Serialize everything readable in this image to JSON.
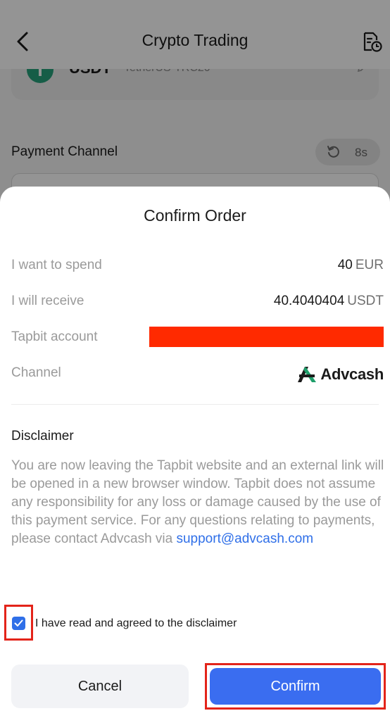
{
  "header": {
    "title": "Crypto Trading",
    "back_icon": "chevron-left-icon",
    "orders_icon": "document-clock-icon"
  },
  "token": {
    "symbol": "USDT",
    "network": "TetherUS-TRC20"
  },
  "payment": {
    "label": "Payment Channel",
    "refresh_countdown": "8s"
  },
  "modal": {
    "title": "Confirm Order",
    "rows": {
      "spend_label": "I want to spend",
      "spend_amount": "40",
      "spend_currency": "EUR",
      "receive_label": "I will receive",
      "receive_amount": "40.4040404",
      "receive_currency": "USDT",
      "account_label": "Tapbit account",
      "channel_label": "Channel",
      "channel_name": "Advcash"
    },
    "disclaimer": {
      "title": "Disclaimer",
      "text": "You are now leaving the Tapbit website and an external link will be opened in a new browser window. Tapbit does not assume any responsibility for any loss or damage caused by the use of this payment service. For any questions relating to payments, please contact Advcash via",
      "email": "support@advcash.com"
    },
    "agree": {
      "label": "I have read and agreed to the disclaimer",
      "checked": true
    },
    "buttons": {
      "cancel": "Cancel",
      "confirm": "Confirm"
    }
  },
  "colors": {
    "primary": "#3a6df0",
    "link": "#2f6fe8",
    "highlight": "#e3241a",
    "redaction": "#ff2a00"
  }
}
